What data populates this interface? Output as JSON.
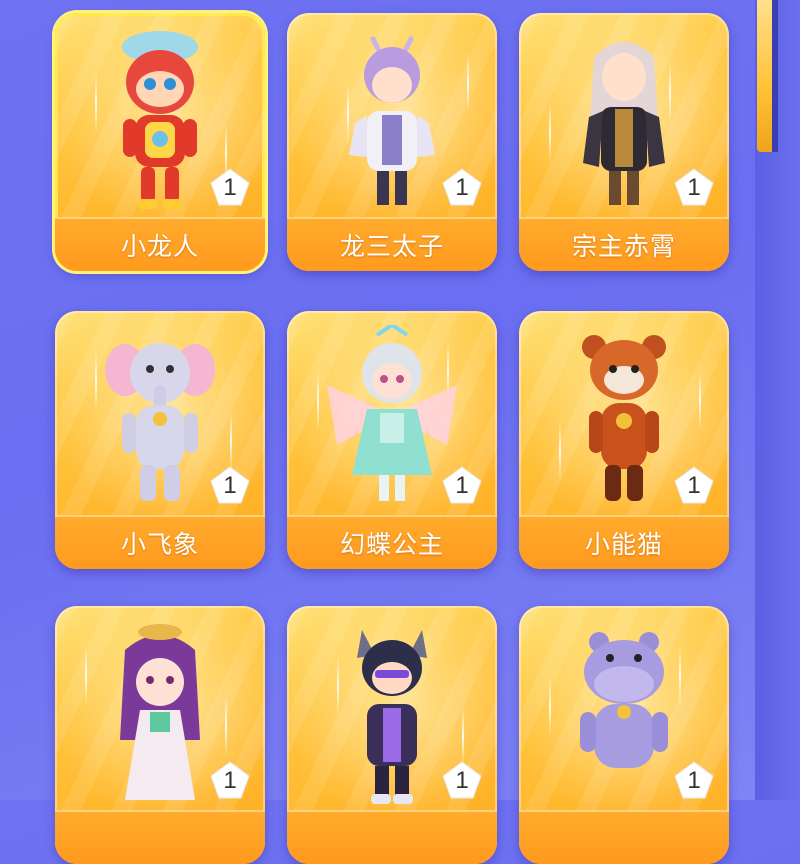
{
  "scrollbar": {
    "thumb_color": "#ffc234"
  },
  "cards": [
    {
      "name": "小龙人",
      "count": "1",
      "icon": "dragon-kid-avatar-icon",
      "selected": true
    },
    {
      "name": "龙三太子",
      "count": "1",
      "icon": "dragon-prince-avatar-icon",
      "selected": false
    },
    {
      "name": "宗主赤霄",
      "count": "1",
      "icon": "sect-master-avatar-icon",
      "selected": false
    },
    {
      "name": "小飞象",
      "count": "1",
      "icon": "flying-elephant-avatar-icon",
      "selected": false
    },
    {
      "name": "幻蝶公主",
      "count": "1",
      "icon": "butterfly-princess-avatar-icon",
      "selected": false
    },
    {
      "name": "小能猫",
      "count": "1",
      "icon": "red-panda-avatar-icon",
      "selected": false
    },
    {
      "name": "",
      "count": "1",
      "icon": "purple-hair-girl-avatar-icon",
      "selected": false
    },
    {
      "name": "",
      "count": "1",
      "icon": "cat-ear-boy-avatar-icon",
      "selected": false
    },
    {
      "name": "",
      "count": "1",
      "icon": "hippo-avatar-icon",
      "selected": false
    }
  ],
  "colors": {
    "card_gold": "#ffc640",
    "name_bar": "#ff9a1e",
    "background": "#6f73f2",
    "selected_border": "#ffe94a"
  }
}
